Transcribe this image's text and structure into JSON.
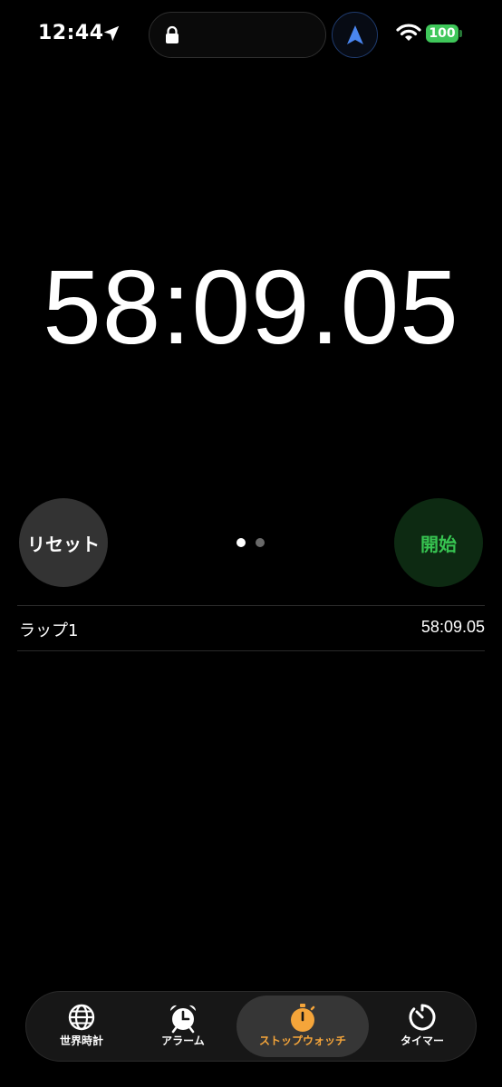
{
  "status_bar": {
    "time": "12:44",
    "battery": "100",
    "battery_color": "#3fc75a"
  },
  "stopwatch": {
    "elapsed": "58:09.05"
  },
  "controls": {
    "reset_label": "リセット",
    "start_label": "開始",
    "start_color": "#37c451",
    "page_count": 2,
    "active_page": 0
  },
  "laps": [
    {
      "label": "ラップ1",
      "time": "58:09.05"
    }
  ],
  "tabs": [
    {
      "label": "世界時計",
      "icon": "globe-icon",
      "active": false
    },
    {
      "label": "アラーム",
      "icon": "alarm-clock-icon",
      "active": false
    },
    {
      "label": "ストップウォッチ",
      "icon": "stopwatch-icon",
      "active": true
    },
    {
      "label": "タイマー",
      "icon": "timer-icon",
      "active": false
    }
  ],
  "accent_color": "#f5a53a"
}
